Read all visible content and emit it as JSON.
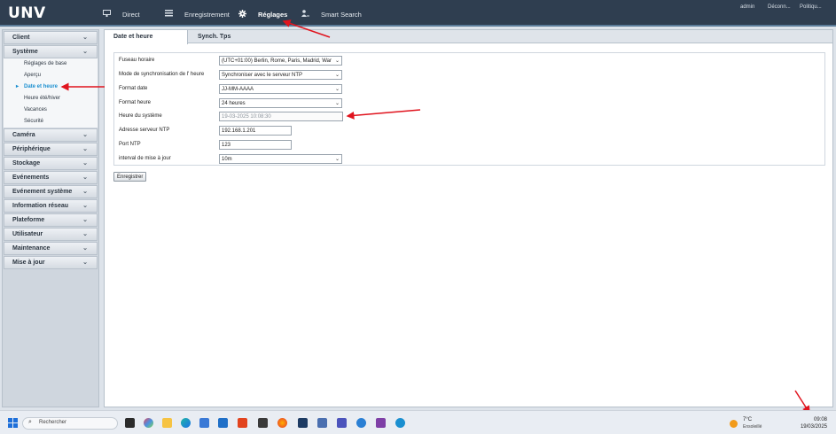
{
  "header": {
    "logo": "UNV",
    "nav": [
      {
        "label": "Direct",
        "icon": "monitor-icon"
      },
      {
        "label": "Enregistrement",
        "icon": "list-icon"
      },
      {
        "label": "Réglages",
        "icon": "gear-icon",
        "active": true
      },
      {
        "label": "Smart Search",
        "icon": "person-search-icon"
      }
    ],
    "user_links": [
      "admin",
      "Déconn...",
      "Politiqu..."
    ]
  },
  "sidebar": {
    "categories": [
      {
        "label": "Client"
      },
      {
        "label": "Système",
        "items": [
          {
            "label": "Réglages de base"
          },
          {
            "label": "Aperçu"
          },
          {
            "label": "Date et heure",
            "active": true
          },
          {
            "label": "Heure été/hiver"
          },
          {
            "label": "Vacances"
          },
          {
            "label": "Sécurité"
          }
        ]
      },
      {
        "label": "Caméra"
      },
      {
        "label": "Périphérique"
      },
      {
        "label": "Stockage"
      },
      {
        "label": "Evénements"
      },
      {
        "label": "Evénement système"
      },
      {
        "label": "Information réseau"
      },
      {
        "label": "Plateforme"
      },
      {
        "label": "Utilisateur"
      },
      {
        "label": "Maintenance"
      },
      {
        "label": "Mise à jour"
      }
    ]
  },
  "tabs": [
    {
      "label": "Date et heure",
      "active": true
    },
    {
      "label": "Synch. Tps"
    }
  ],
  "form": {
    "fuseau_label": "Fuseau horaire",
    "fuseau_value": "(UTC+01:00) Berlin, Rome, Paris, Madrid, War",
    "mode_label": "Mode de synchronisation de l'  heure",
    "mode_value": "Synchroniser avec le serveur NTP",
    "format_date_label": "Format date",
    "format_date_value": "JJ-MM-AAAA",
    "format_heure_label": "Format heure",
    "format_heure_value": "24 heures",
    "heure_systeme_label": "Heure du système",
    "heure_systeme_value": "19-03-2025 10:08:30",
    "ntp_address_label": "Adresse serveur NTP",
    "ntp_address_value": "192.168.1.201",
    "ntp_port_label": "Port NTP",
    "ntp_port_value": "123",
    "interval_label": "interval de mise à jour",
    "interval_value": "10m",
    "save_label": "Enregistrer"
  },
  "taskbar": {
    "search_placeholder": "Rechercher",
    "weather_temp": "7°C",
    "weather_desc": "Ensoleillé",
    "time": "09:08",
    "date": "19/03/2025"
  },
  "colors": {
    "header_bg": "#2f3e50",
    "active_link": "#1a8fd0",
    "annotation": "#e0141e"
  }
}
